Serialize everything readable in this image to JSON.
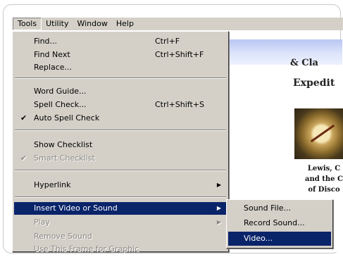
{
  "menubar": {
    "items": [
      "Tools",
      "Utility",
      "Window",
      "Help"
    ]
  },
  "tools_menu": {
    "find": {
      "label": "Find...",
      "shortcut": "Ctrl+F"
    },
    "find_next": {
      "label": "Find Next",
      "shortcut": "Ctrl+Shift+F"
    },
    "replace": {
      "label": "Replace..."
    },
    "word_guide": {
      "label": "Word Guide..."
    },
    "spell_check": {
      "label": "Spell Check...",
      "shortcut": "Ctrl+Shift+S"
    },
    "auto_spell_check": {
      "label": "Auto Spell Check",
      "check": "✔"
    },
    "show_checklist": {
      "label": "Show Checklist"
    },
    "smart_checklist": {
      "label": "Smart Checklist",
      "check": "✔"
    },
    "hyperlink": {
      "label": "Hyperlink",
      "arrow": "▶"
    },
    "insert_video_or_sound": {
      "label": "Insert Video or Sound",
      "arrow": "▶"
    },
    "play": {
      "label": "Play",
      "arrow": "▶"
    },
    "remove_sound": {
      "label": "Remove Sound"
    },
    "use_this_frame": {
      "label": "Use This Frame for Graphic"
    }
  },
  "submenu": {
    "sound_file": "Sound File...",
    "record_sound": "Record Sound...",
    "video": "Video..."
  },
  "document": {
    "title_line1": "& Cla",
    "title_line2": "Expedit",
    "caption_line1": "Lewis, C",
    "caption_line2": "and the C",
    "caption_line3": "of Disco"
  },
  "colors": {
    "menu_bg": "#d4d0c8",
    "highlight": "#0a246a",
    "disabled_text": "#8c8a86"
  }
}
